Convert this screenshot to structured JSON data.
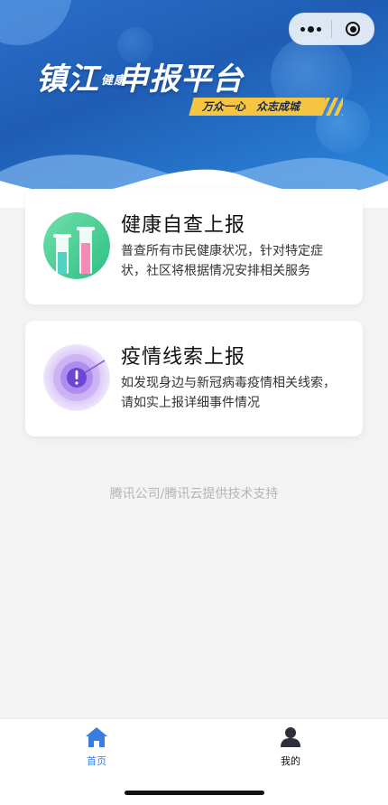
{
  "banner": {
    "title_left": "镇江",
    "title_small": "健康",
    "title_right": "申报平台",
    "slogan": "万众一心　众志成城"
  },
  "cards": [
    {
      "title": "健康自查上报",
      "desc": "普查所有市民健康状况，针对特定症状，社区将根据情况安排相关服务",
      "icon": "test-tubes-icon"
    },
    {
      "title": "疫情线索上报",
      "desc": "如发现身边与新冠病毒疫情相关线索，请如实上报详细事件情况",
      "icon": "alert-radar-icon"
    }
  ],
  "footer": {
    "support_text": "腾讯公司/腾讯云提供技术支持"
  },
  "tabbar": {
    "home_label": "首页",
    "mine_label": "我的"
  },
  "colors": {
    "banner_blue": "#2166c1",
    "accent_yellow": "#f6c642",
    "tab_active": "#3a7ce0"
  }
}
